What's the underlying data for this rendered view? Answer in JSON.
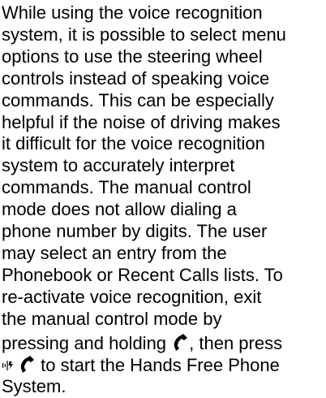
{
  "paragraph": {
    "lines": [
      "While using the voice recognition",
      "system, it is possible to select menu",
      "options to use the steering wheel",
      "controls instead of speaking voice",
      "commands. This can be especially",
      "helpful if the noise of driving makes",
      "it difficult for the voice recognition",
      "system to accurately interpret",
      "commands. The manual control",
      "mode does not allow dialing a",
      "phone number by digits. The user",
      "may select an entry from the",
      "Phonebook or Recent Calls lists. To",
      "re-activate voice recognition, exit",
      "the manual control mode by"
    ],
    "pressing_holding_text": "pressing and holding ",
    "then_press_text": ", then press",
    "start_text": " to start the Hands Free Phone",
    "final_text": "System."
  },
  "icons": {
    "phone": "phone-handset-icon",
    "voice": "voice-recognition-icon"
  }
}
